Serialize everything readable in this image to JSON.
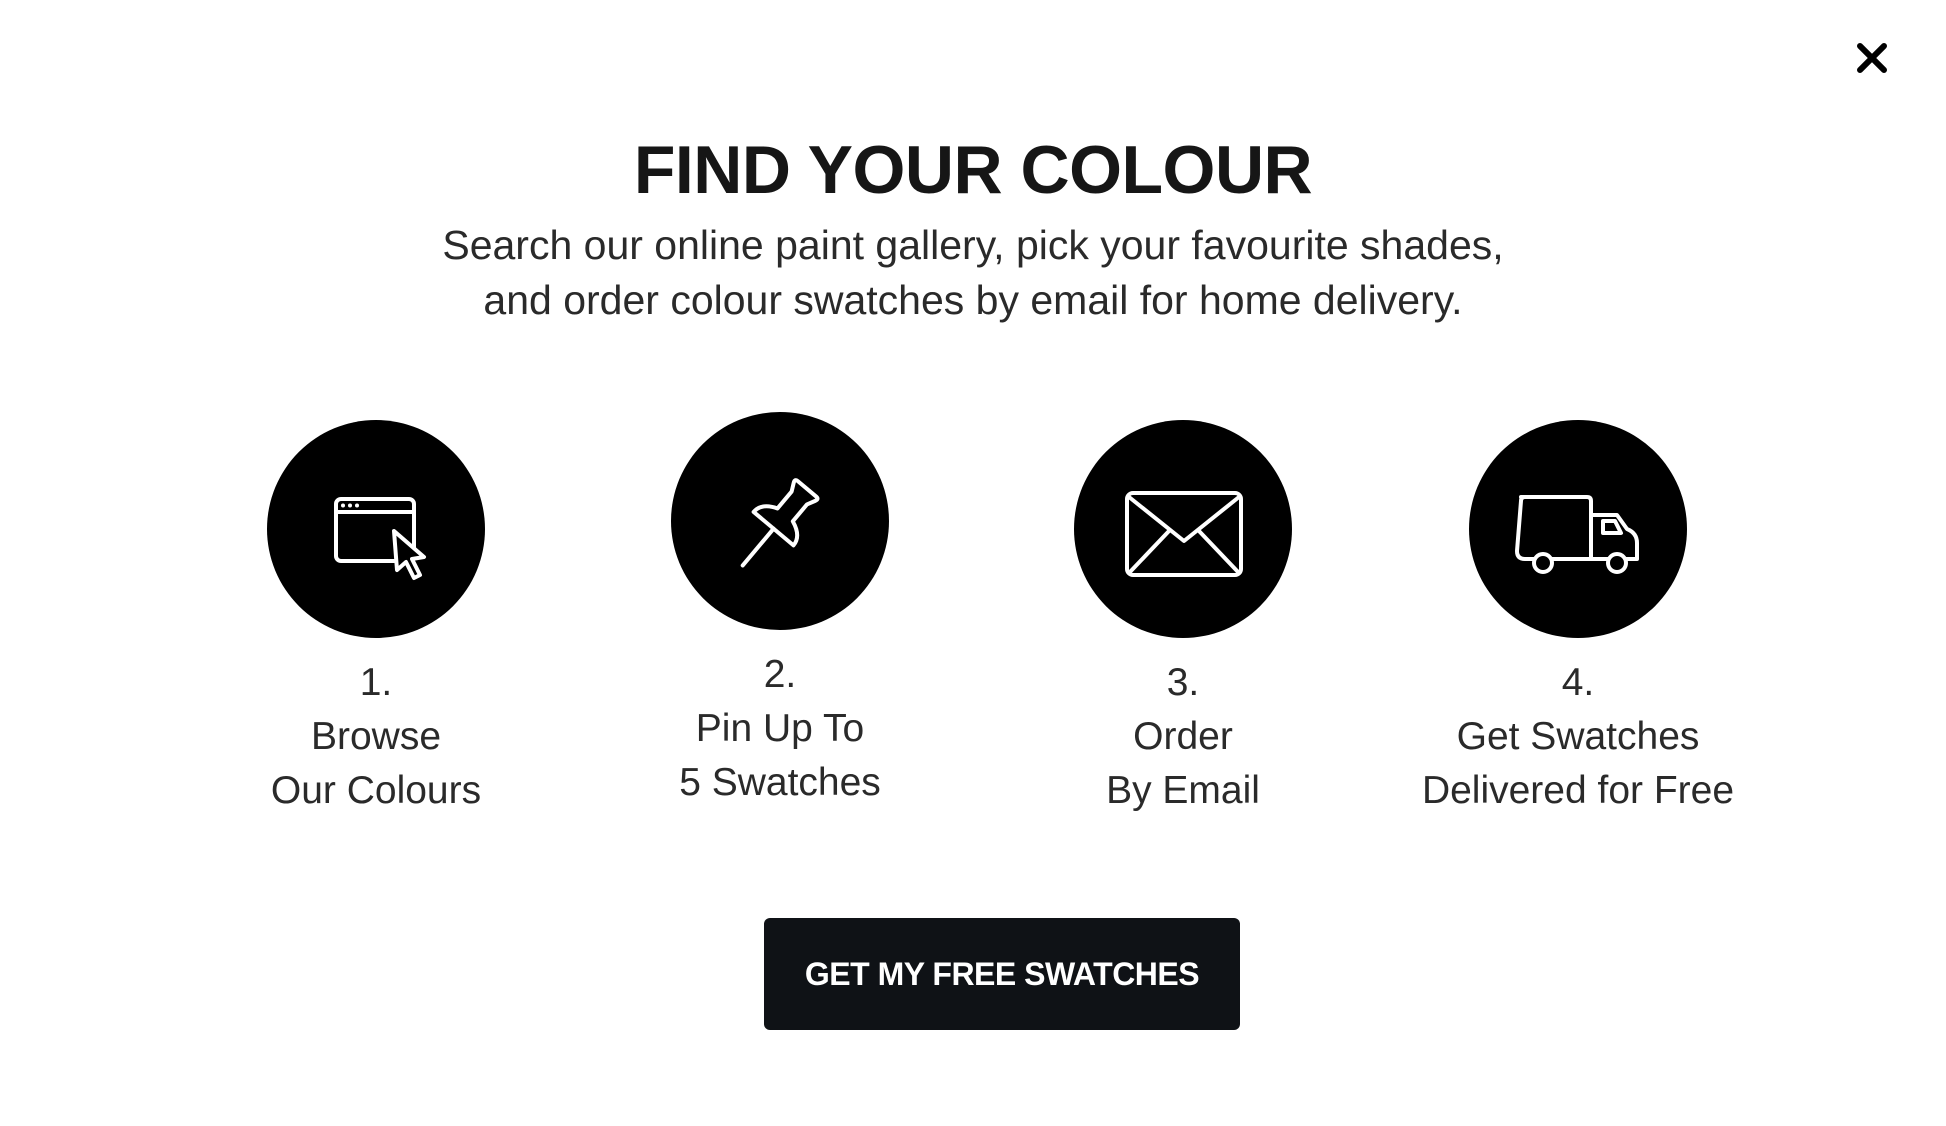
{
  "modal": {
    "close_icon": "close-icon",
    "title": "FIND YOUR COLOUR",
    "subtitle_lines": [
      "Search our online paint gallery, pick your favourite shades,",
      "and order colour swatches by email for home delivery."
    ],
    "steps": [
      {
        "number": "1.",
        "line1": "Browse",
        "line2": "Our Colours",
        "icon": "browser-cursor-icon"
      },
      {
        "number": "2.",
        "line1": "Pin Up To",
        "line2": "5 Swatches",
        "icon": "pushpin-icon"
      },
      {
        "number": "3.",
        "line1": "Order",
        "line2": "By Email",
        "icon": "envelope-icon"
      },
      {
        "number": "4.",
        "line1": "Get Swatches",
        "line2": "Delivered for Free",
        "icon": "delivery-truck-icon"
      }
    ],
    "cta_label": "GET MY FREE SWATCHES"
  },
  "colors": {
    "background": "#ffffff",
    "icon_circle": "#000000",
    "cta_background": "#0f1216",
    "cta_text": "#ffffff",
    "text": "#1a1a1a"
  }
}
